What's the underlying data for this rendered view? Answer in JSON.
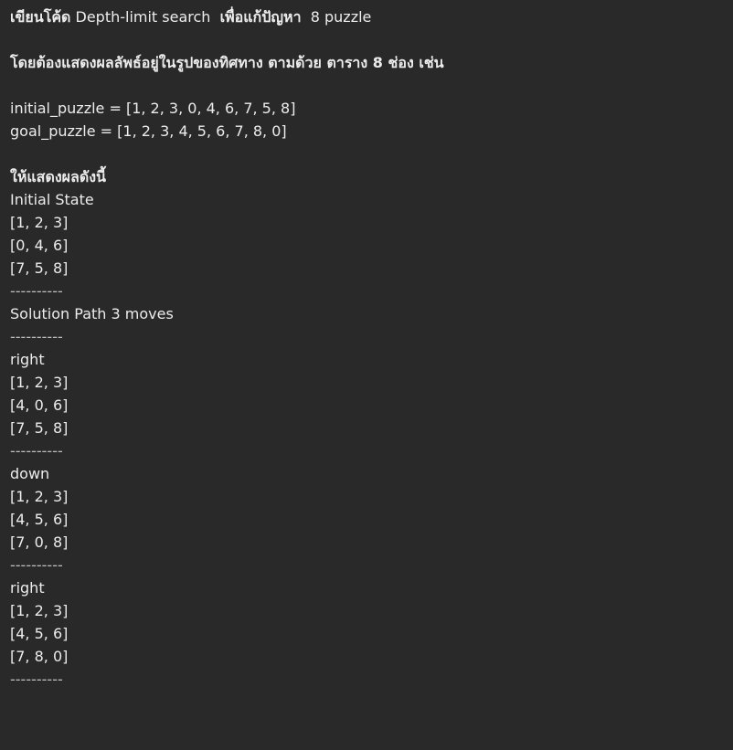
{
  "header": {
    "title_bold_1": "เขียนโค้ด",
    "title_text_1": " Depth-limit search  ",
    "title_bold_2": "เพื่อแก้ปัญหา",
    "title_text_2": "  8 puzzle",
    "subtitle": "โดยต้องแสดงผลลัพธ์อยู่ในรูปของทิศทาง ตามด้วย ตาราง 8 ช่อง เช่น"
  },
  "inputs": {
    "initial_line": "initial_puzzle = [1, 2, 3, 0, 4, 6, 7, 5, 8]",
    "goal_line": "goal_puzzle = [1, 2, 3, 4, 5, 6, 7, 8, 0]"
  },
  "output": {
    "heading": "ให้แสดงผลดังนี้",
    "initial_label": "Initial State",
    "initial_rows": [
      "[1, 2, 3]",
      "[0, 4, 6]",
      "[7, 5, 8]"
    ],
    "separator": "----------",
    "solution_label": "Solution Path 3 moves",
    "moves": [
      {
        "direction": "right",
        "rows": [
          "[1, 2, 3]",
          "[4, 0, 6]",
          "[7, 5, 8]"
        ]
      },
      {
        "direction": "down",
        "rows": [
          "[1, 2, 3]",
          "[4, 5, 6]",
          "[7, 0, 8]"
        ]
      },
      {
        "direction": "right",
        "rows": [
          "[1, 2, 3]",
          "[4, 5, 6]",
          "[7, 8, 0]"
        ]
      }
    ]
  }
}
